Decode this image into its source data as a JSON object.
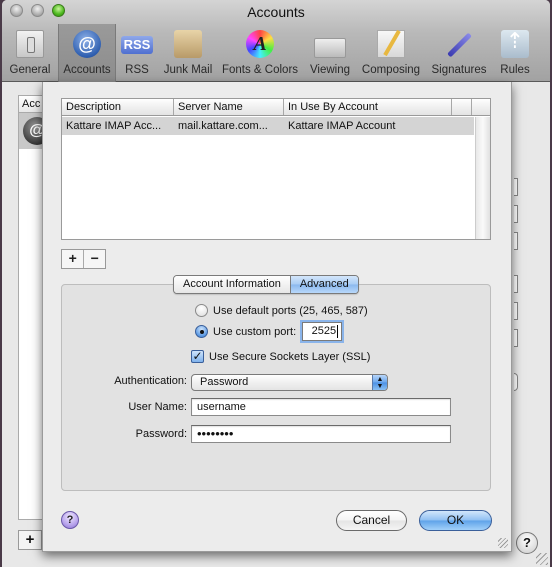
{
  "window": {
    "title": "Accounts"
  },
  "toolbar": {
    "items": [
      {
        "label": "General",
        "icon": "general-switch-icon"
      },
      {
        "label": "Accounts",
        "icon": "at-sign-icon",
        "selected": true
      },
      {
        "label": "RSS",
        "icon": "rss-icon",
        "icon_text": "RSS"
      },
      {
        "label": "Junk Mail",
        "icon": "junk-mail-icon"
      },
      {
        "label": "Fonts & Colors",
        "icon": "fonts-colors-icon",
        "icon_text": "A"
      },
      {
        "label": "Viewing",
        "icon": "viewing-glasses-icon"
      },
      {
        "label": "Composing",
        "icon": "composing-pencil-icon"
      },
      {
        "label": "Signatures",
        "icon": "signatures-pen-icon"
      },
      {
        "label": "Rules",
        "icon": "rules-arrows-icon"
      }
    ]
  },
  "background": {
    "accounts_list_header": "Acc",
    "account_icon_text": "@",
    "add_label": "+",
    "help_label": "?"
  },
  "sheet": {
    "server_table": {
      "columns": [
        "Description",
        "Server Name",
        "In Use By Account"
      ],
      "rows": [
        [
          "Kattare IMAP Acc...",
          "mail.kattare.com...",
          "Kattare IMAP Account"
        ]
      ]
    },
    "add_label": "+",
    "remove_label": "−",
    "tabs": [
      {
        "label": "Account Information",
        "active": false
      },
      {
        "label": "Advanced",
        "active": true
      }
    ],
    "advanced": {
      "port_options": [
        {
          "label": "Use default ports (25, 465, 587)",
          "selected": false
        },
        {
          "label": "Use custom port:",
          "selected": true
        }
      ],
      "custom_port_value": "2525",
      "ssl_label": "Use Secure Sockets Layer (SSL)",
      "ssl_checked": true,
      "ssl_check_glyph": "✓",
      "authentication_label": "Authentication:",
      "authentication_value": "Password",
      "authentication_arrows": "▲▼",
      "username_label": "User Name:",
      "username_value": "username",
      "password_label": "Password:",
      "password_value": "••••••••"
    },
    "help_label": "?",
    "cancel_label": "Cancel",
    "ok_label": "OK"
  },
  "colors": {
    "accent_blue": "#6aa6ec",
    "selected_row": "#d4d4d4",
    "help_purple": "#b8a4ec"
  }
}
